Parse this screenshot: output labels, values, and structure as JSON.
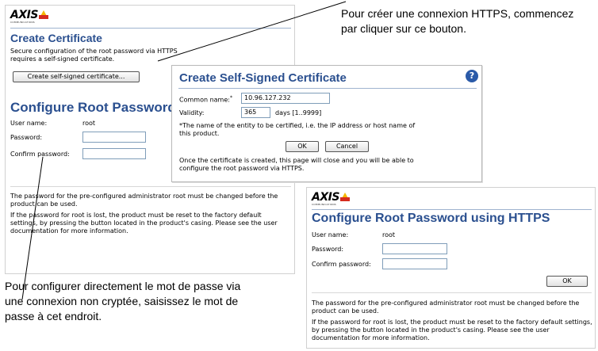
{
  "callouts": {
    "https_line1": "Pour créer une connexion HTTPS, commencez",
    "https_line2": "par cliquer sur ce bouton.",
    "direct_line1": "Pour configurer directement le mot de passe via",
    "direct_line2": "une connexion non cryptée, saisissez le mot de",
    "direct_line3": "passe à cet endroit."
  },
  "brand": {
    "logo": "AXIS",
    "tagline": "COMMUNICATIONS"
  },
  "main_page": {
    "cert_title": "Create Certificate",
    "cert_desc": "Secure configuration of the root password via HTTPS requires a self-signed certificate.",
    "create_button": "Create self-signed certificate...",
    "root_title": "Configure Root Password",
    "user_label": "User name:",
    "user_value": "root",
    "password_label": "Password:",
    "confirm_label": "Confirm password:",
    "note1": "The password for the pre-configured administrator root must be changed before the product can be used.",
    "note2": "If the password for root is lost, the product must be reset to the factory default settings, by pressing the button located in the product's casing. Please see the user documentation for more information."
  },
  "dialog": {
    "title": "Create Self-Signed Certificate",
    "help_icon": "?",
    "common_name_label": "Common name:",
    "common_name_required": "*",
    "common_name_value": "10.96.127.232",
    "validity_label": "Validity:",
    "validity_value": "365",
    "validity_units": "days [1..9999]",
    "footnote": "*The name of the entity to be certified, i.e. the IP address or host name of this product.",
    "ok": "OK",
    "cancel": "Cancel",
    "after_text": "Once the certificate is created, this page will close and you will be able to configure the root password via HTTPS."
  },
  "https_page": {
    "title": "Configure Root Password using HTTPS",
    "user_label": "User name:",
    "user_value": "root",
    "password_label": "Password:",
    "confirm_label": "Confirm password:",
    "ok": "OK",
    "note1": "The password for the pre-configured administrator root must be changed before the product can be used.",
    "note2": "If the password for root is lost, the product must be reset to the factory default settings, by pressing the button located in the product's casing. Please see the user documentation for more information."
  }
}
